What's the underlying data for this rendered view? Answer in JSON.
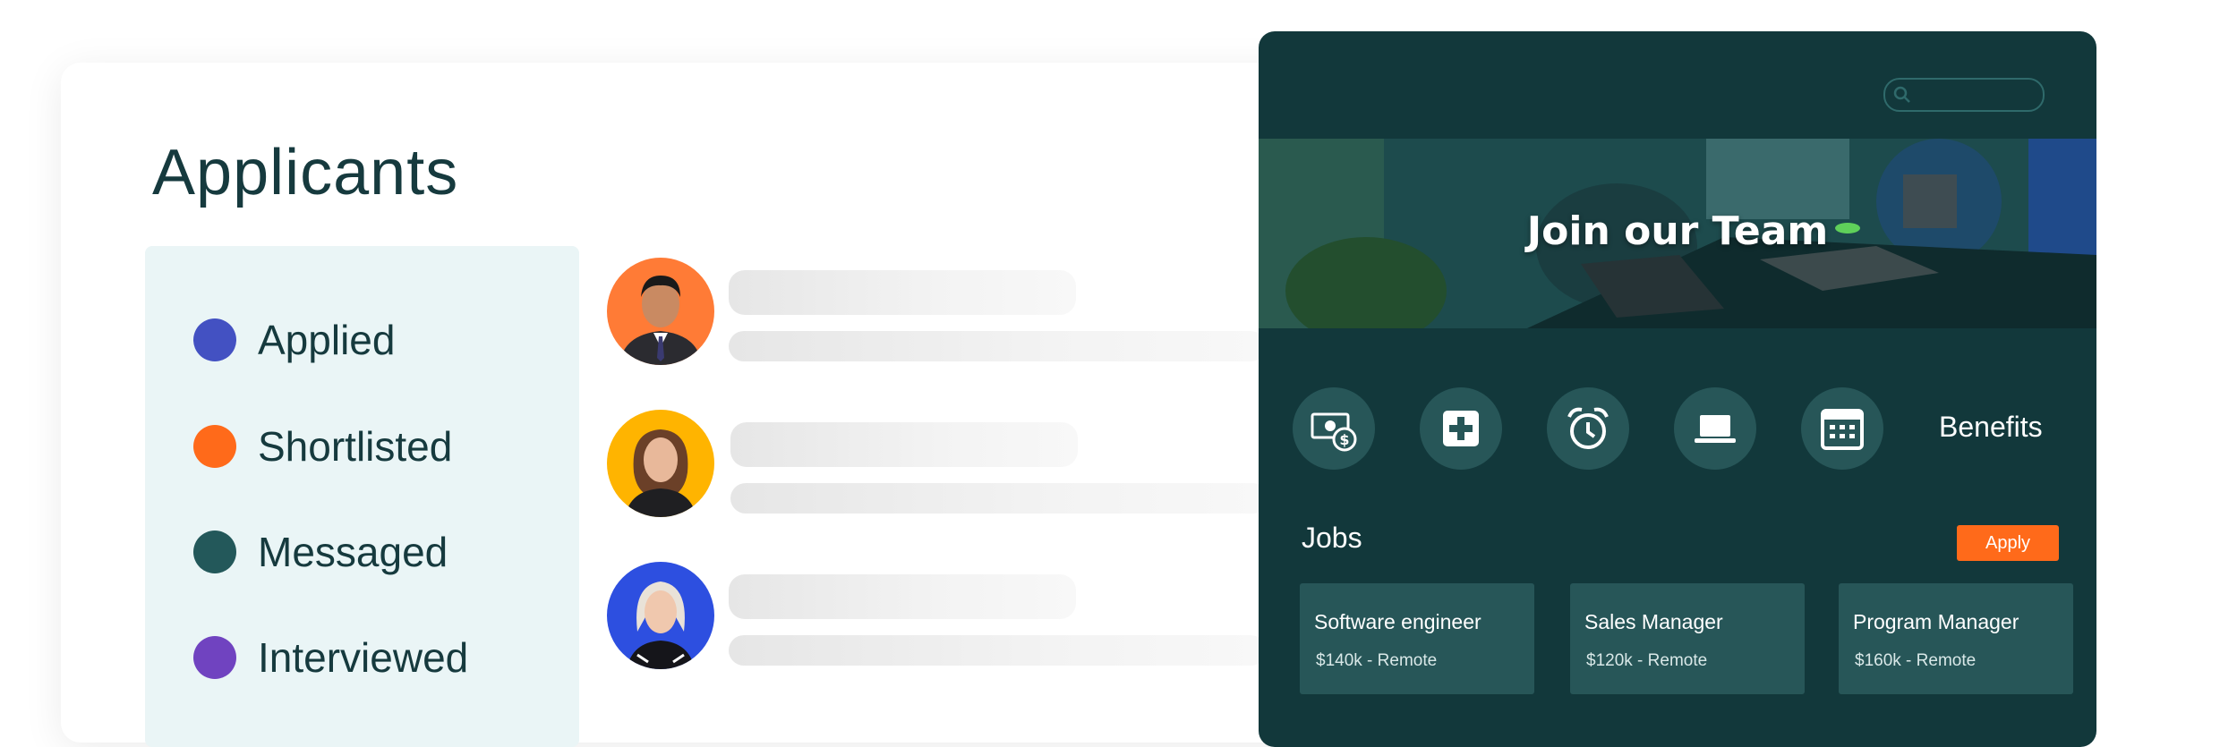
{
  "applicants": {
    "title": "Applicants",
    "statuses": [
      {
        "label": "Applied",
        "color": "#4351c2"
      },
      {
        "label": "Shortlisted",
        "color": "#ff6a1a"
      },
      {
        "label": "Messaged",
        "color": "#23585a"
      },
      {
        "label": "Interviewed",
        "color": "#7043c0"
      }
    ],
    "avatar_colors": [
      "#ff7b36",
      "#ffb400",
      "#2d4fe0"
    ]
  },
  "careers": {
    "search": {
      "icon": "search-icon",
      "value": ""
    },
    "hero_title": "Join our Team",
    "benefit_icons": [
      "money-icon",
      "health-icon",
      "alarm-clock-icon",
      "laptop-icon",
      "calendar-icon"
    ],
    "benefits_label": "Benefits",
    "jobs_label": "Jobs",
    "apply_label": "Apply",
    "jobs": [
      {
        "title": "Software engineer",
        "meta": "$140k - Remote"
      },
      {
        "title": "Sales Manager",
        "meta": "$120k - Remote"
      },
      {
        "title": "Program Manager",
        "meta": "$160k - Remote"
      }
    ],
    "colors": {
      "panel": "#12383b",
      "card": "#275658",
      "accent": "#ff6a1a"
    }
  }
}
